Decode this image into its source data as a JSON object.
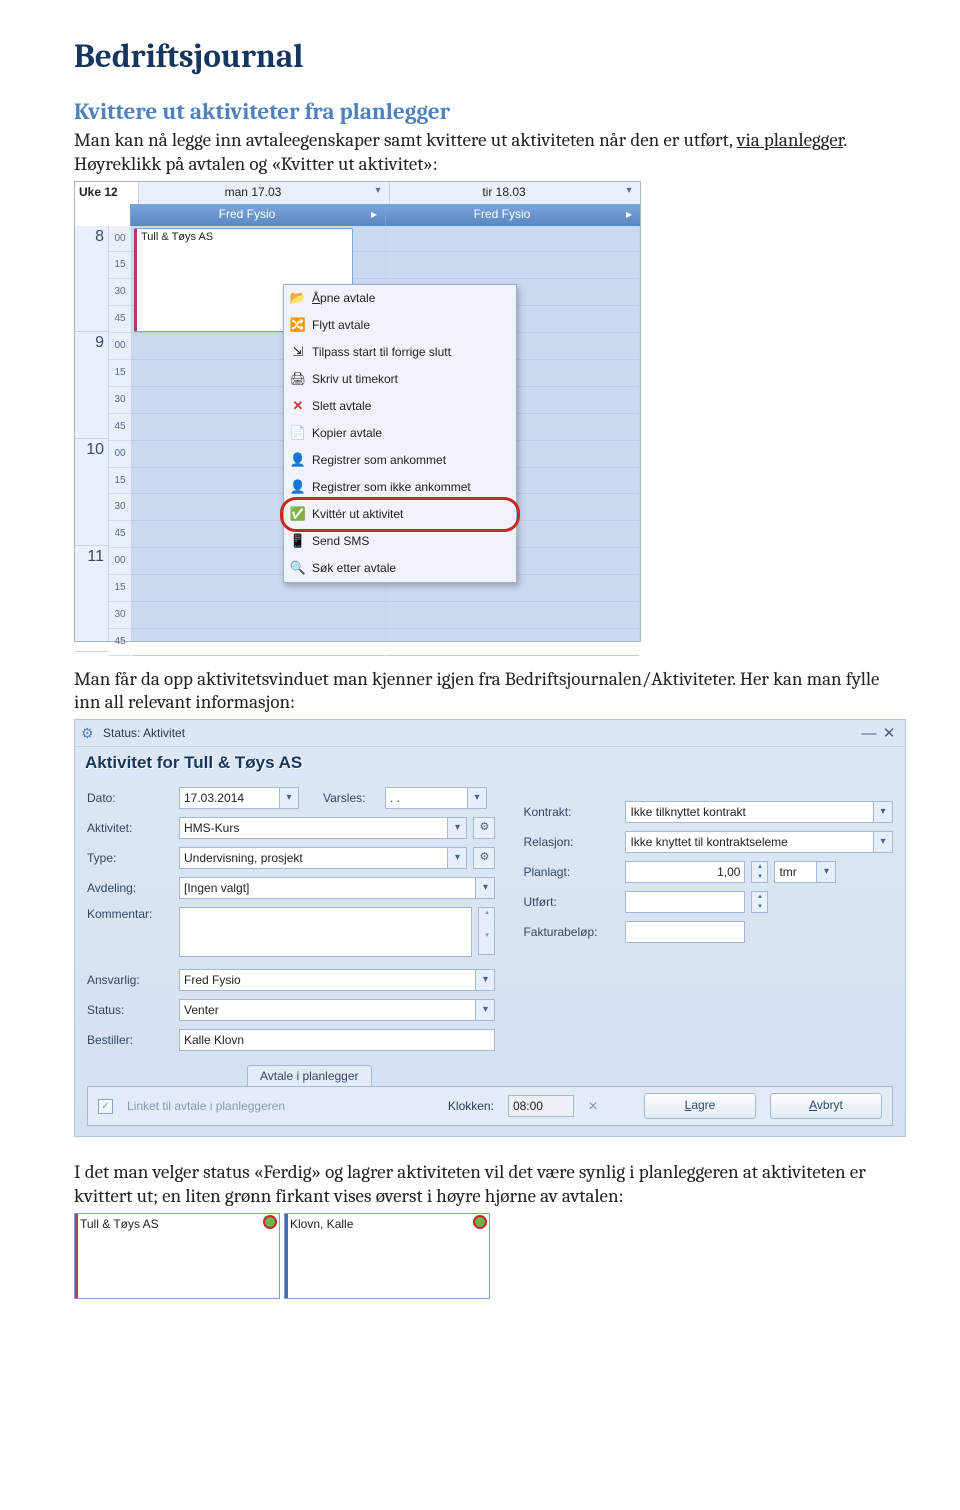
{
  "doc": {
    "h1": "Bedriftsjournal",
    "h2": "Kvittere ut aktiviteter fra planlegger",
    "p1a": "Man kan nå legge inn avtaleegenskaper samt kvittere ut aktiviteten når den er utført, ",
    "p1_via": "via planlegger",
    "p1b": ". Høyreklikk på avtalen og «Kvitter ut aktivitet»:",
    "p2": "Man får da opp aktivitetsvinduet man kjenner igjen fra Bedriftsjournalen/Aktiviteter. Her kan man fylle inn all relevant informasjon:",
    "p3": "I det man velger status «Ferdig» og lagrer aktiviteten vil det være synlig i planleggeren at aktiviteten er kvittert ut; en liten grønn firkant vises øverst i høyre hjørne av avtalen:"
  },
  "planner": {
    "week": "Uke 12",
    "day1": "man 17.03",
    "day2": "tir 18.03",
    "name": "Fred Fysio",
    "hours": [
      "8",
      "9",
      "10",
      "11"
    ],
    "mins": [
      "00",
      "15",
      "30",
      "45",
      "00",
      "15",
      "30",
      "45",
      "00",
      "15",
      "30",
      "45",
      "00",
      "15",
      "30",
      "45"
    ],
    "appt": "Tull & Tøys AS",
    "menu": {
      "open": "Åpne avtale",
      "move": "Flytt avtale",
      "fit": "Tilpass start til forrige slutt",
      "print": "Skriv ut timekort",
      "delete": "Slett avtale",
      "copy": "Kopier avtale",
      "arrived": "Registrer som ankommet",
      "notarrived": "Registrer som ikke ankommet",
      "kvitter": "Kvittér ut aktivitet",
      "sms": "Send SMS",
      "search": "Søk etter avtale"
    }
  },
  "form": {
    "winTitle": "Status: Aktivitet",
    "heading": "Aktivitet for Tull & Tøys AS",
    "labels": {
      "dato": "Dato:",
      "varsles": "Varsles:",
      "aktivitet": "Aktivitet:",
      "type": "Type:",
      "avdeling": "Avdeling:",
      "kommentar": "Kommentar:",
      "ansvarlig": "Ansvarlig:",
      "status": "Status:",
      "bestiller": "Bestiller:",
      "kontrakt": "Kontrakt:",
      "relasjon": "Relasjon:",
      "planlagt": "Planlagt:",
      "utfort": "Utført:",
      "fakturabelop": "Fakturabeløp:",
      "klokken": "Klokken:",
      "linket": "Linket til avtale i planleggeren"
    },
    "values": {
      "dato": "17.03.2014",
      "varsles": ". .",
      "aktivitet": "HMS-Kurs",
      "type": "Undervisning, prosjekt",
      "avdeling": "[Ingen valgt]",
      "kommentar": "",
      "ansvarlig": "Fred Fysio",
      "status": "Venter",
      "bestiller": "Kalle Klovn",
      "kontrakt": "Ikke tilknyttet kontrakt",
      "relasjon": "Ikke knyttet til kontraktseleme",
      "planlagt": "1,00",
      "planlagtUnit": "tmr",
      "utfort": "",
      "fakturabelop": "",
      "klokken": "08:00",
      "tab": "Avtale i planlegger",
      "lagre": "Lagre",
      "avbryt": "Avbryt"
    }
  },
  "minis": {
    "a": "Tull & Tøys AS",
    "b": "Klovn, Kalle"
  }
}
